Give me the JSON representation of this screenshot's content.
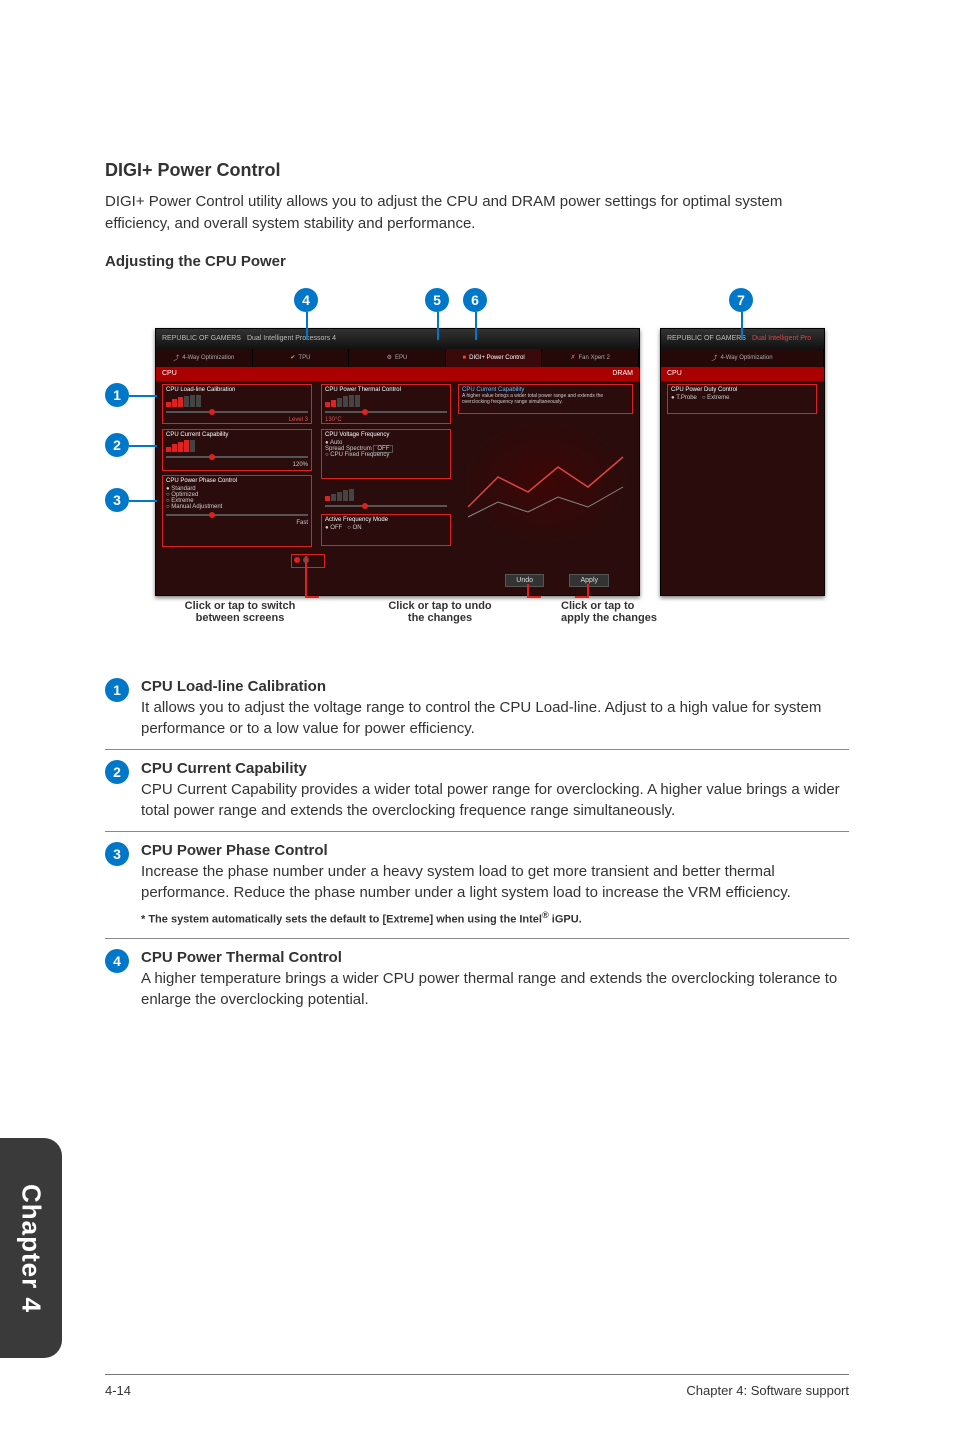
{
  "section": {
    "title": "DIGI+ Power Control",
    "intro": "DIGI+ Power Control utility allows you to adjust the CPU and DRAM power settings for optimal system efficiency, and overall system stability and performance.",
    "sub_heading": "Adjusting the CPU Power"
  },
  "diagram": {
    "markers": {
      "m1": "1",
      "m2": "2",
      "m3": "3",
      "m4": "4",
      "m5": "5",
      "m6": "6",
      "m7": "7"
    },
    "captions": {
      "switch_screens_l1": "Click or tap to switch",
      "switch_screens_l2": "between screens",
      "undo_l1": "Click or tap to undo",
      "undo_l2": "the changes",
      "apply_l1": "Click or tap to",
      "apply_l2": "apply the changes"
    },
    "shot": {
      "brand": "REPUBLIC OF GAMERS",
      "title": "Dual Intelligent Processors 4",
      "tabs": {
        "opt": "4-Way Optimization",
        "tpu": "TPU",
        "epu": "EPU",
        "digi": "DIGI+ Power Control",
        "fan": "Fan Xpert 2"
      },
      "cpu_label": "CPU",
      "dram_label": "DRAM",
      "panels": {
        "loadline_title": "CPU Load-line Calibration",
        "loadline_level": "Level 3",
        "current_title": "CPU Current Capability",
        "current_value": "120%",
        "phase_title": "CPU Power Phase Control",
        "phase_opt1": "Standard",
        "phase_opt2": "Optimized",
        "phase_opt3": "Extreme",
        "phase_opt4": "Manual Adjustment",
        "phase_fast": "Fast",
        "thermal_title": "CPU Power Thermal Control",
        "thermal_value": "130°C",
        "voltfreq_title": "CPU Voltage Frequency",
        "vf_auto": "Auto",
        "vf_spread": "Spread Spectrum",
        "vf_spread_state": "OFF",
        "vf_fixed": "CPU Fixed Frequency",
        "activefreq_title": "Active Frequency Mode",
        "off": "OFF",
        "on": "ON",
        "cap_title": "CPU Current Capability",
        "cap_text": "A higher value brings a wider total power range and extends the overclocking frequency range simultaneously.",
        "duty_title": "CPU Power Duty Control",
        "duty_opt1": "T.Probe",
        "duty_opt2": "Extreme"
      },
      "buttons": {
        "undo": "Undo",
        "apply": "Apply"
      }
    }
  },
  "callouts": [
    {
      "num": "1",
      "title": "CPU Load-line Calibration",
      "body": "It allows you to adjust the voltage range to control the CPU Load-line. Adjust to a high value for system performance or to a low value for power efficiency."
    },
    {
      "num": "2",
      "title": "CPU Current Capability",
      "body": "CPU Current Capability provides a wider total power range for overclocking. A higher value brings a wider total power range and extends the overclocking frequence range simultaneously."
    },
    {
      "num": "3",
      "title": "CPU Power Phase Control",
      "body": "Increase the phase number under a heavy system load to get more transient and better thermal performance. Reduce the phase number under a light system load to increase the VRM efficiency.",
      "note_prefix": "* The system automatically sets the default to [Extreme] when using the Intel",
      "note_suffix": " iGPU.",
      "note_sup": "®"
    },
    {
      "num": "4",
      "title": "CPU Power Thermal Control",
      "body": "A higher temperature brings a wider CPU power thermal range and extends the overclocking tolerance to enlarge the overclocking potential."
    }
  ],
  "side_tab": "Chapter 4",
  "footer": {
    "left": "4-14",
    "right": "Chapter 4: Software support"
  }
}
